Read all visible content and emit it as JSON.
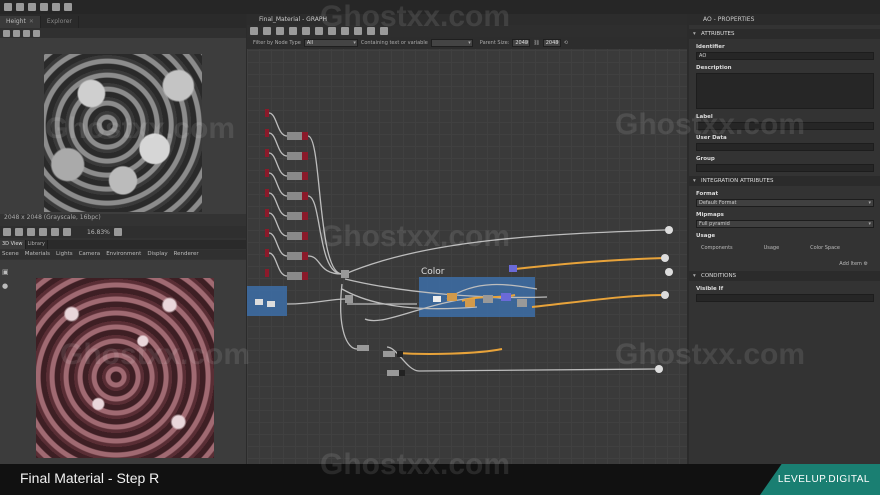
{
  "left_panel": {
    "tabs": [
      "Height",
      "Explorer"
    ],
    "resolution_info": "2048 x 2048 (Grayscale, 16bpc)",
    "zoom": "16.83%",
    "view_tabs": [
      "3D View",
      "Library"
    ],
    "menu": [
      "Scene",
      "Materials",
      "Lights",
      "Camera",
      "Environment",
      "Display",
      "Renderer"
    ]
  },
  "graph": {
    "title": "Final_Material - GRAPH",
    "filter_label": "Filter by Node Type",
    "filter_value": "All",
    "search_label": "Containing text or variable",
    "parent_size_label": "Parent Size:",
    "parent_size_value": "2048",
    "size_value": "2048",
    "frame_label": "Color"
  },
  "properties": {
    "title": "AO - PROPERTIES",
    "sections": [
      "ATTRIBUTES",
      "INTEGRATION ATTRIBUTES",
      "CONDITIONS"
    ],
    "identifier_label": "Identifier",
    "identifier_value": "AO",
    "description_label": "Description",
    "label_label": "Label",
    "user_data_label": "User Data",
    "group_label": "Group",
    "format_label": "Format",
    "format_value": "Default Format",
    "mipmaps_label": "Mipmaps",
    "mipmaps_value": "Full pyramid",
    "usage_label": "Usage",
    "usage_columns": [
      "Components",
      "Usage",
      "Color Space"
    ],
    "add_item": "Add Item",
    "visible_if_label": "Visible If"
  },
  "footer": {
    "title": "Final Material - Step R",
    "brand": "LEVELUP.DIGITAL"
  },
  "watermark": "Ghostxx.com",
  "colors": {
    "orange_wire": "#e8a33a",
    "blue_wire": "#6a6ad8",
    "frame_blue": "#3d6fa8",
    "brand_green": "#1a7f72"
  }
}
